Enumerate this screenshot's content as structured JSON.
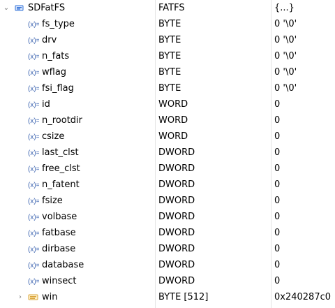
{
  "rows": [
    {
      "name": "SDFatFS",
      "type": "FATFS",
      "value": "{...}",
      "icon": "struct-icon",
      "expander": "expanded"
    },
    {
      "name": "fs_type",
      "type": "BYTE",
      "value": "0 '\\0'",
      "icon": "variable-icon"
    },
    {
      "name": "drv",
      "type": "BYTE",
      "value": "0 '\\0'",
      "icon": "variable-icon"
    },
    {
      "name": "n_fats",
      "type": "BYTE",
      "value": "0 '\\0'",
      "icon": "variable-icon"
    },
    {
      "name": "wflag",
      "type": "BYTE",
      "value": "0 '\\0'",
      "icon": "variable-icon"
    },
    {
      "name": "fsi_flag",
      "type": "BYTE",
      "value": "0 '\\0'",
      "icon": "variable-icon"
    },
    {
      "name": "id",
      "type": "WORD",
      "value": "0",
      "icon": "variable-icon"
    },
    {
      "name": "n_rootdir",
      "type": "WORD",
      "value": "0",
      "icon": "variable-icon"
    },
    {
      "name": "csize",
      "type": "WORD",
      "value": "0",
      "icon": "variable-icon"
    },
    {
      "name": "last_clst",
      "type": "DWORD",
      "value": "0",
      "icon": "variable-icon"
    },
    {
      "name": "free_clst",
      "type": "DWORD",
      "value": "0",
      "icon": "variable-icon"
    },
    {
      "name": "n_fatent",
      "type": "DWORD",
      "value": "0",
      "icon": "variable-icon"
    },
    {
      "name": "fsize",
      "type": "DWORD",
      "value": "0",
      "icon": "variable-icon"
    },
    {
      "name": "volbase",
      "type": "DWORD",
      "value": "0",
      "icon": "variable-icon"
    },
    {
      "name": "fatbase",
      "type": "DWORD",
      "value": "0",
      "icon": "variable-icon"
    },
    {
      "name": "dirbase",
      "type": "DWORD",
      "value": "0",
      "icon": "variable-icon"
    },
    {
      "name": "database",
      "type": "DWORD",
      "value": "0",
      "icon": "variable-icon"
    },
    {
      "name": "winsect",
      "type": "DWORD",
      "value": "0",
      "icon": "variable-icon"
    },
    {
      "name": "win",
      "type": "BYTE [512]",
      "value": "0x240287c0",
      "icon": "array-icon",
      "expander": "collapsed"
    }
  ],
  "colors": {
    "variable_icon": "#3b63b0",
    "struct_icon": "#2f6fd6",
    "array_icon": "#d9a43a",
    "separator": "#e3e3e3"
  }
}
